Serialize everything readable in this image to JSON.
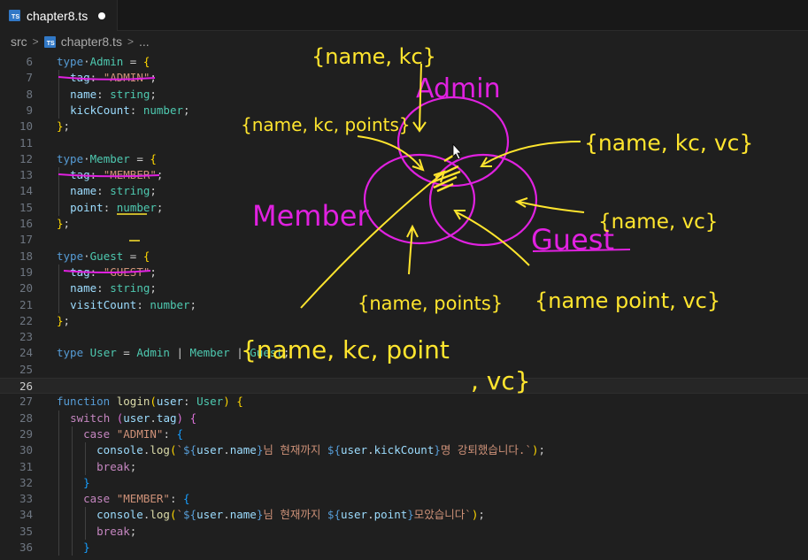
{
  "tab": {
    "filename": "chapter8.ts",
    "icon": "typescript-file-icon",
    "icon_text": "TS"
  },
  "breadcrumb": {
    "folder": "src",
    "file": "chapter8.ts",
    "more": "..."
  },
  "editor": {
    "lines": [
      {
        "no": "6",
        "tokens": [
          [
            "kw",
            "type"
          ],
          [
            "",
            "·"
          ],
          [
            "ty",
            "Admin"
          ],
          [
            "",
            " = "
          ],
          [
            "br1",
            "{"
          ]
        ]
      },
      {
        "no": "7",
        "tokens": [
          [
            "",
            "  "
          ],
          [
            "prop",
            "tag"
          ],
          [
            "",
            ": "
          ],
          [
            "str",
            "\"ADMIN\""
          ],
          [
            "",
            ";"
          ]
        ]
      },
      {
        "no": "8",
        "tokens": [
          [
            "",
            "  "
          ],
          [
            "prop",
            "name"
          ],
          [
            "",
            ": "
          ],
          [
            "ty",
            "string"
          ],
          [
            "",
            ";"
          ]
        ]
      },
      {
        "no": "9",
        "tokens": [
          [
            "",
            "  "
          ],
          [
            "prop",
            "kickCount"
          ],
          [
            "",
            ": "
          ],
          [
            "ty",
            "number"
          ],
          [
            "",
            ";"
          ]
        ]
      },
      {
        "no": "10",
        "tokens": [
          [
            "br1",
            "}"
          ],
          [
            "",
            ";"
          ]
        ]
      },
      {
        "no": "11",
        "tokens": []
      },
      {
        "no": "12",
        "tokens": [
          [
            "kw",
            "type"
          ],
          [
            "",
            "·"
          ],
          [
            "ty",
            "Member"
          ],
          [
            "",
            " = "
          ],
          [
            "br1",
            "{"
          ]
        ]
      },
      {
        "no": "13",
        "tokens": [
          [
            "",
            "  "
          ],
          [
            "prop",
            "tag"
          ],
          [
            "",
            ": "
          ],
          [
            "str",
            "\"MEMBER\""
          ],
          [
            "",
            ";"
          ]
        ]
      },
      {
        "no": "14",
        "tokens": [
          [
            "",
            "  "
          ],
          [
            "prop",
            "name"
          ],
          [
            "",
            ": "
          ],
          [
            "ty",
            "string"
          ],
          [
            "",
            ";"
          ]
        ]
      },
      {
        "no": "15",
        "tokens": [
          [
            "",
            "  "
          ],
          [
            "prop",
            "point"
          ],
          [
            "",
            ": "
          ],
          [
            "ty",
            "number"
          ],
          [
            "",
            ";"
          ]
        ]
      },
      {
        "no": "16",
        "tokens": [
          [
            "br1",
            "}"
          ],
          [
            "",
            ";"
          ]
        ]
      },
      {
        "no": "17",
        "tokens": []
      },
      {
        "no": "18",
        "tokens": [
          [
            "kw",
            "type"
          ],
          [
            "",
            "·"
          ],
          [
            "ty",
            "Guest"
          ],
          [
            "",
            " = "
          ],
          [
            "br1",
            "{"
          ]
        ]
      },
      {
        "no": "19",
        "tokens": [
          [
            "",
            "  "
          ],
          [
            "prop",
            "tag"
          ],
          [
            "",
            ": "
          ],
          [
            "str",
            "\"GUEST\""
          ],
          [
            "",
            ";"
          ]
        ]
      },
      {
        "no": "20",
        "tokens": [
          [
            "",
            "  "
          ],
          [
            "prop",
            "name"
          ],
          [
            "",
            ": "
          ],
          [
            "ty",
            "string"
          ],
          [
            "",
            ";"
          ]
        ]
      },
      {
        "no": "21",
        "tokens": [
          [
            "",
            "  "
          ],
          [
            "prop",
            "visitCount"
          ],
          [
            "",
            ": "
          ],
          [
            "ty",
            "number"
          ],
          [
            "",
            ";"
          ]
        ]
      },
      {
        "no": "22",
        "tokens": [
          [
            "br1",
            "}"
          ],
          [
            "",
            ";"
          ]
        ]
      },
      {
        "no": "23",
        "tokens": []
      },
      {
        "no": "24",
        "tokens": [
          [
            "kw",
            "type"
          ],
          [
            "",
            " "
          ],
          [
            "ty",
            "User"
          ],
          [
            "",
            " = "
          ],
          [
            "ty",
            "Admin"
          ],
          [
            "",
            " | "
          ],
          [
            "ty",
            "Member"
          ],
          [
            "",
            " | "
          ],
          [
            "ty",
            "Guest"
          ],
          [
            "",
            ";"
          ]
        ]
      },
      {
        "no": "25",
        "tokens": []
      },
      {
        "no": "26",
        "tokens": [],
        "current": true
      },
      {
        "no": "27",
        "tokens": [
          [
            "kw",
            "function"
          ],
          [
            "",
            " "
          ],
          [
            "fn",
            "login"
          ],
          [
            "br1",
            "("
          ],
          [
            "prop",
            "user"
          ],
          [
            "",
            ": "
          ],
          [
            "ty",
            "User"
          ],
          [
            "br1",
            ")"
          ],
          [
            "",
            " "
          ],
          [
            "br1",
            "{"
          ]
        ]
      },
      {
        "no": "28",
        "tokens": [
          [
            "",
            "  "
          ],
          [
            "ctl",
            "switch"
          ],
          [
            "",
            " "
          ],
          [
            "br2",
            "("
          ],
          [
            "prop",
            "user"
          ],
          [
            "",
            "."
          ],
          [
            "prop",
            "tag"
          ],
          [
            "br2",
            ")"
          ],
          [
            "",
            " "
          ],
          [
            "br2",
            "{"
          ]
        ]
      },
      {
        "no": "29",
        "tokens": [
          [
            "",
            "    "
          ],
          [
            "ctl",
            "case"
          ],
          [
            "",
            " "
          ],
          [
            "str",
            "\"ADMIN\""
          ],
          [
            "",
            ": "
          ],
          [
            "br3",
            "{"
          ]
        ]
      },
      {
        "no": "30",
        "tokens": [
          [
            "",
            "      "
          ],
          [
            "prop",
            "console"
          ],
          [
            "",
            "."
          ],
          [
            "fn",
            "log"
          ],
          [
            "br1",
            "("
          ],
          [
            "str",
            "`"
          ],
          [
            "kw",
            "${"
          ],
          [
            "prop",
            "user"
          ],
          [
            "",
            "."
          ],
          [
            "prop",
            "name"
          ],
          [
            "kw",
            "}"
          ],
          [
            "str",
            "님 현재까지 "
          ],
          [
            "kw",
            "${"
          ],
          [
            "prop",
            "user"
          ],
          [
            "",
            "."
          ],
          [
            "prop",
            "kickCount"
          ],
          [
            "kw",
            "}"
          ],
          [
            "str",
            "명 강퇴했습니다.`"
          ],
          [
            "br1",
            ")"
          ],
          [
            "",
            ";"
          ]
        ]
      },
      {
        "no": "31",
        "tokens": [
          [
            "",
            "      "
          ],
          [
            "ctl",
            "break"
          ],
          [
            "",
            ";"
          ]
        ]
      },
      {
        "no": "32",
        "tokens": [
          [
            "",
            "    "
          ],
          [
            "br3",
            "}"
          ]
        ]
      },
      {
        "no": "33",
        "tokens": [
          [
            "",
            "    "
          ],
          [
            "ctl",
            "case"
          ],
          [
            "",
            " "
          ],
          [
            "str",
            "\"MEMBER\""
          ],
          [
            "",
            ": "
          ],
          [
            "br3",
            "{"
          ]
        ]
      },
      {
        "no": "34",
        "tokens": [
          [
            "",
            "      "
          ],
          [
            "prop",
            "console"
          ],
          [
            "",
            "."
          ],
          [
            "fn",
            "log"
          ],
          [
            "br1",
            "("
          ],
          [
            "str",
            "`"
          ],
          [
            "kw",
            "${"
          ],
          [
            "prop",
            "user"
          ],
          [
            "",
            "."
          ],
          [
            "prop",
            "name"
          ],
          [
            "kw",
            "}"
          ],
          [
            "str",
            "님 현재까지 "
          ],
          [
            "kw",
            "${"
          ],
          [
            "prop",
            "user"
          ],
          [
            "",
            "."
          ],
          [
            "prop",
            "point"
          ],
          [
            "kw",
            "}"
          ],
          [
            "str",
            "모았습니다`"
          ],
          [
            "br1",
            ")"
          ],
          [
            "",
            ";"
          ]
        ]
      },
      {
        "no": "35",
        "tokens": [
          [
            "",
            "      "
          ],
          [
            "ctl",
            "break"
          ],
          [
            "",
            ";"
          ]
        ]
      },
      {
        "no": "36",
        "tokens": [
          [
            "",
            "    "
          ],
          [
            "br3",
            "}"
          ]
        ]
      }
    ]
  },
  "annotations": {
    "admin_label": "Admin",
    "member_label": "Member",
    "guest_label": "Guest",
    "admin_fields": "{name, kc}",
    "admin_member_fields": "{name, kc, points}",
    "admin_guest_fields": "{name, kc, vc}",
    "guest_fields": "{name, vc}",
    "member_fields": "{name, points}",
    "member_guest_fields": "{name point, vc}",
    "all_fields_line1": "{name, kc, point",
    "all_fields_line2": ", vc}",
    "magenta": "#e021e0",
    "yellow": "#ffe52e"
  }
}
